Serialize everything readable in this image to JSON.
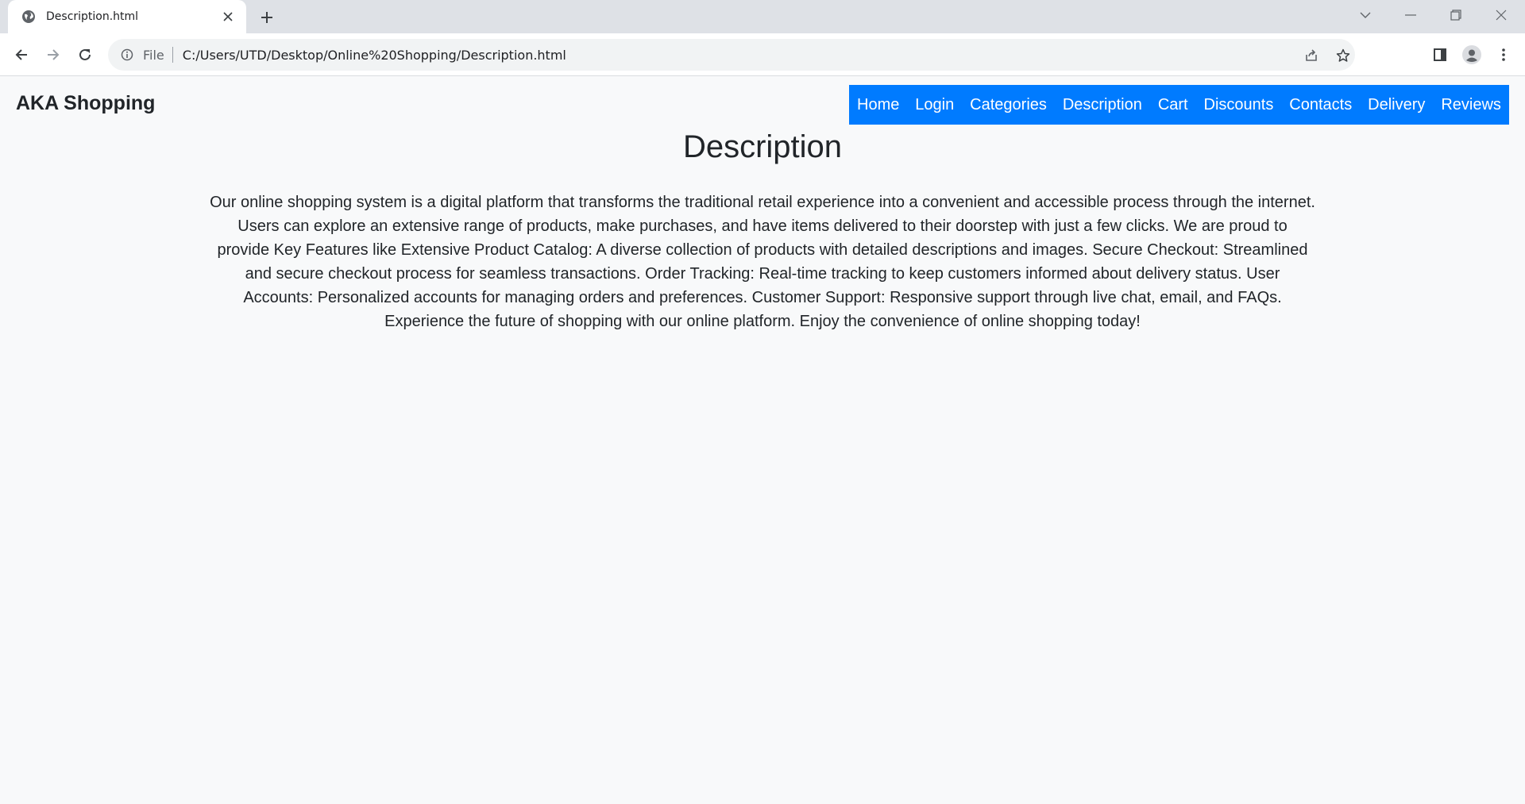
{
  "browser": {
    "tab": {
      "title": "Description.html",
      "favicon_icon": "globe-icon"
    },
    "address_bar": {
      "scheme_label": "File",
      "url": "C:/Users/UTD/Desktop/Online%20Shopping/Description.html"
    }
  },
  "site": {
    "brand": "AKA Shopping",
    "nav_items": [
      "Home",
      "Login",
      "Categories",
      "Description",
      "Cart",
      "Discounts",
      "Contacts",
      "Delivery",
      "Reviews"
    ],
    "accent_color": "#007bff"
  },
  "content": {
    "heading": "Description",
    "body": "Our online shopping system is a digital platform that transforms the traditional retail experience into a convenient and accessible process through the internet. Users can explore an extensive range of products, make purchases, and have items delivered to their doorstep with just a few clicks. We are proud to provide Key Features like Extensive Product Catalog: A diverse collection of products with detailed descriptions and images. Secure Checkout: Streamlined and secure checkout process for seamless transactions. Order Tracking: Real-time tracking to keep customers informed about delivery status. User Accounts: Personalized accounts for managing orders and preferences. Customer Support: Responsive support through live chat, email, and FAQs. Experience the future of shopping with our online platform. Enjoy the convenience of online shopping today!"
  }
}
